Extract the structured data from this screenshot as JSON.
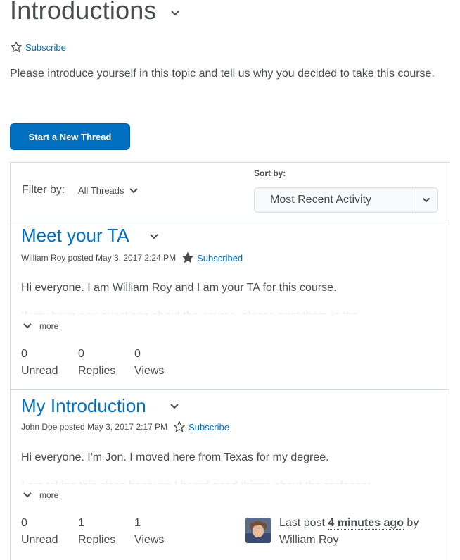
{
  "topic": {
    "title": "Introductions",
    "subscribe_label": "Subscribe",
    "description": "Please introduce yourself in this topic and tell us why you decided to take this course."
  },
  "actions": {
    "start_thread_label": "Start a New Thread"
  },
  "filter": {
    "label": "Filter by:",
    "value": "All Threads"
  },
  "sort": {
    "label": "Sort by:",
    "value": "Most Recent Activity"
  },
  "threads": [
    {
      "title": "Meet your TA",
      "meta": "William Roy posted May 3, 2017 2:24 PM",
      "subscription_label": "Subscribed",
      "body": "Hi everyone. I am William Roy and I am your TA for this course.",
      "preview": "If you have any questions about the course, please post them in the",
      "more_label": "more",
      "stats": [
        {
          "value": "0",
          "label": "Unread"
        },
        {
          "value": "0",
          "label": "Replies"
        },
        {
          "value": "0",
          "label": "Views"
        }
      ]
    },
    {
      "title": "My Introduction",
      "meta": "John Doe posted May 3, 2017 2:17 PM",
      "subscription_label": "Subscribe",
      "body": "Hi everyone. I'm Jon. I moved here from Texas for my degree.",
      "preview": "I am taking this class because I heard good things about the professor",
      "more_label": "more",
      "stats": [
        {
          "value": "0",
          "label": "Unread"
        },
        {
          "value": "1",
          "label": "Replies"
        },
        {
          "value": "1",
          "label": "Views"
        }
      ],
      "last_post": {
        "prefix": "Last post",
        "time": "4 minutes ago",
        "by": "by",
        "author": "William Roy"
      }
    }
  ],
  "colors": {
    "link": "#006fbf",
    "text": "#494c4e",
    "border": "#d3d9e3"
  }
}
